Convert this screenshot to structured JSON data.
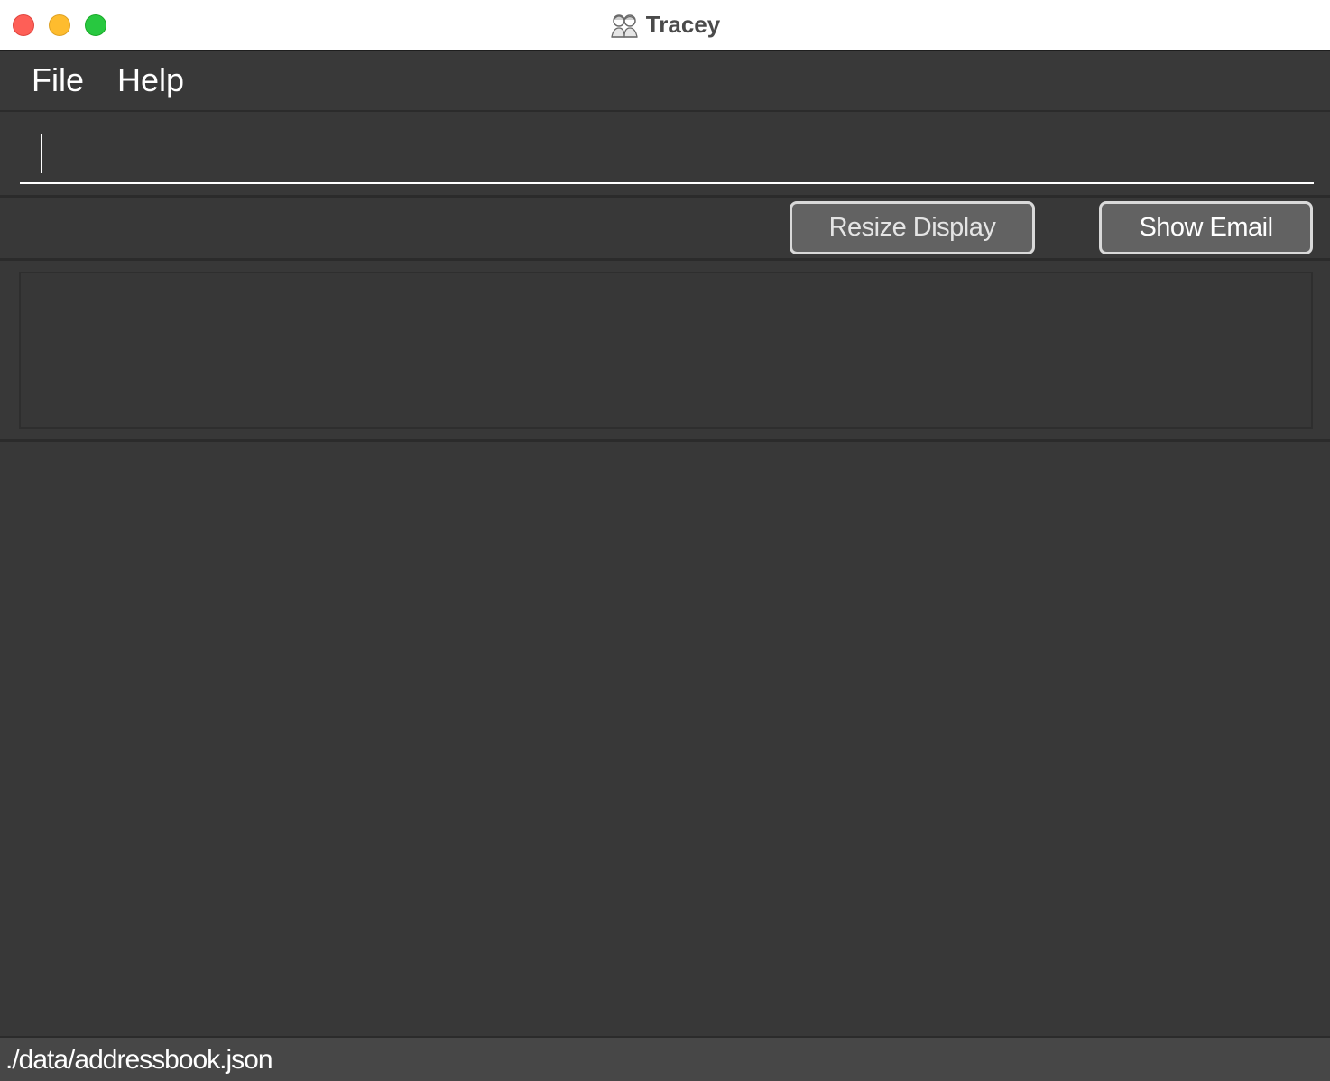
{
  "window": {
    "title": "Tracey",
    "app_icon": "two-people-icon"
  },
  "menu": {
    "file_label": "File",
    "help_label": "Help"
  },
  "command_box": {
    "value": "",
    "placeholder": ""
  },
  "toolbar": {
    "resize_display_label": "Resize Display",
    "show_email_label": "Show Email"
  },
  "result_display": {
    "text": ""
  },
  "status_bar": {
    "save_location": "./data/addressbook.json"
  },
  "colors": {
    "background": "#383838",
    "status_bar": "#474747",
    "button_fill": "#626262",
    "button_border": "#d9d9d9",
    "close": "#fe5f57",
    "minimize": "#febc2e",
    "zoom": "#28c840"
  }
}
